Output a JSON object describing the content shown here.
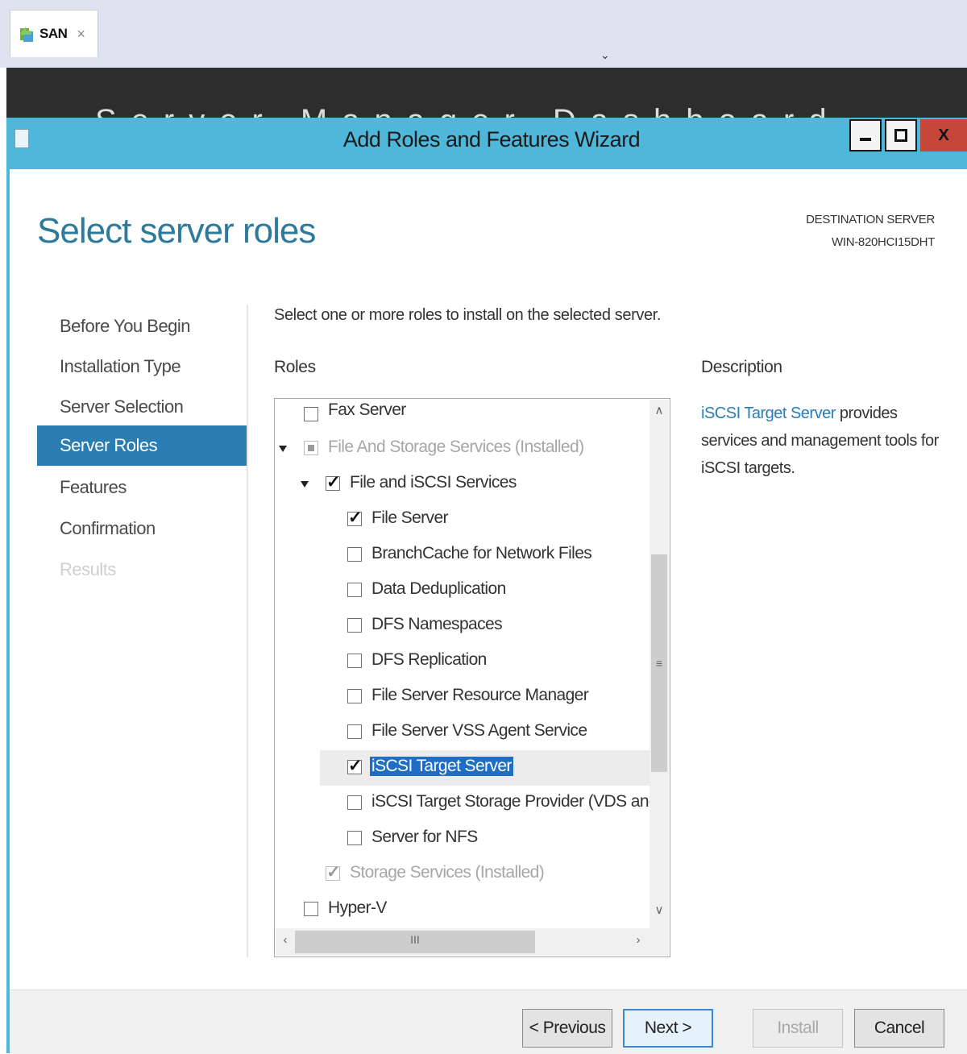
{
  "browser_tab": {
    "label": "SAN",
    "close": "×",
    "dropdown": "⌄"
  },
  "background_app": {
    "title": "Server Manager Dashboard"
  },
  "window": {
    "title": "Add Roles and Features Wizard",
    "minimize": "",
    "maximize": "",
    "close": "X"
  },
  "page": {
    "title": "Select server roles",
    "destination_label": "DESTINATION SERVER",
    "destination_value": "WIN-820HCI15DHT",
    "instruction": "Select one or more roles to install on the selected server."
  },
  "nav": {
    "items": [
      {
        "label": "Before You Begin",
        "state": "normal"
      },
      {
        "label": "Installation Type",
        "state": "normal"
      },
      {
        "label": "Server Selection",
        "state": "normal"
      },
      {
        "label": "Server Roles",
        "state": "active"
      },
      {
        "label": "Features",
        "state": "normal"
      },
      {
        "label": "Confirmation",
        "state": "normal"
      },
      {
        "label": "Results",
        "state": "disabled"
      }
    ]
  },
  "roles": {
    "header": "Roles",
    "items": [
      {
        "label": "Fax Server",
        "checked": false,
        "expandable": false,
        "installed": false
      },
      {
        "label": "File And Storage Services (Installed)",
        "checked": "partial",
        "expandable": true,
        "installed": true
      },
      {
        "label": "File and iSCSI Services",
        "checked": true,
        "expandable": true,
        "installed": false
      },
      {
        "label": "File Server",
        "checked": true,
        "expandable": false,
        "installed": false
      },
      {
        "label": "BranchCache for Network Files",
        "checked": false,
        "expandable": false,
        "installed": false
      },
      {
        "label": "Data Deduplication",
        "checked": false,
        "expandable": false,
        "installed": false
      },
      {
        "label": "DFS Namespaces",
        "checked": false,
        "expandable": false,
        "installed": false
      },
      {
        "label": "DFS Replication",
        "checked": false,
        "expandable": false,
        "installed": false
      },
      {
        "label": "File Server Resource Manager",
        "checked": false,
        "expandable": false,
        "installed": false
      },
      {
        "label": "File Server VSS Agent Service",
        "checked": false,
        "expandable": false,
        "installed": false
      },
      {
        "label": "iSCSI Target Server",
        "checked": true,
        "expandable": false,
        "installed": false,
        "selected": true
      },
      {
        "label": "iSCSI Target Storage Provider (VDS and VSS hardware providers)",
        "checked": false,
        "expandable": false,
        "installed": false
      },
      {
        "label": "Server for NFS",
        "checked": false,
        "expandable": false,
        "installed": false
      },
      {
        "label": "Storage Services (Installed)",
        "checked": true,
        "expandable": false,
        "installed": true
      },
      {
        "label": "Hyper-V",
        "checked": false,
        "expandable": false,
        "installed": false
      }
    ]
  },
  "scrollbars": {
    "up": "∧",
    "down": "∨",
    "left": "‹",
    "right": "›",
    "grip_v": "≡",
    "grip_h": "III"
  },
  "description": {
    "header": "Description",
    "link_text": "iSCSI Target Server",
    "body": " provides services and management tools for iSCSI targets."
  },
  "buttons": {
    "previous": "< Previous",
    "next": "Next >",
    "install": "Install",
    "cancel": "Cancel"
  },
  "colors": {
    "titlebar": "#4fb8da",
    "nav_active": "#2a7db3",
    "title_text": "#2e7a9c",
    "selection": "#1f6ec4",
    "close_button": "#c7463a"
  }
}
